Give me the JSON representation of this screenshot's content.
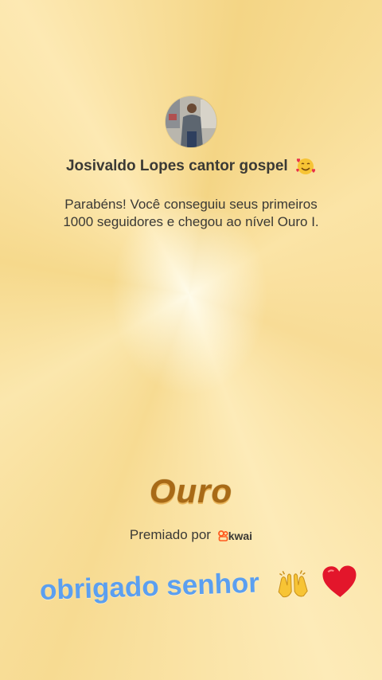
{
  "profile": {
    "name": "Josivaldo Lopes cantor gospel",
    "name_emoji": "smiling-face-with-hearts-icon"
  },
  "message": {
    "line1": "Parabéns! Você conseguiu seus primeiros",
    "line2": "1000 seguidores e chegou ao nível Ouro I."
  },
  "level": {
    "title": "Ouro",
    "color": "#a86a16"
  },
  "awarded": {
    "label": "Premiado por",
    "brand": "kwai",
    "brand_color": "#ff5a1f"
  },
  "caption": {
    "text": "obrigado senhor",
    "color": "#5b9ff0",
    "emojis": [
      "raising-hands-icon",
      "red-heart-icon"
    ]
  }
}
